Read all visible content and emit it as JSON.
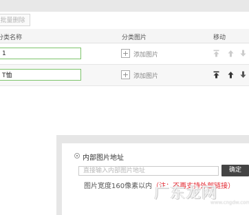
{
  "toolbar": {
    "batch_delete_label": "批量删除"
  },
  "table": {
    "headers": {
      "name": "分类名称",
      "image": "分类图片",
      "move": "移动"
    },
    "rows": [
      {
        "name_value": "1",
        "add_image_label": "添加图片",
        "arrows_enabled": false
      },
      {
        "name_value": "T恤",
        "add_image_label": "添加图片",
        "arrows_enabled": true
      }
    ]
  },
  "icons": {
    "add": "plus-icon",
    "move_top": "move-to-top-icon",
    "move_up": "move-up-icon",
    "move_down": "move-down-icon"
  },
  "popup": {
    "radio_label": "内部图片地址",
    "input_placeholder": "直接输入内部图片地址",
    "confirm_label": "确定",
    "hint_text": "图片宽度160像素以内",
    "hint_warning": "（注：不再支持外部链接）"
  },
  "watermark": {
    "text": "广东龙网",
    "sub": "www.cngdw.com"
  },
  "colors": {
    "input_border_active": "#7cc36a",
    "confirm_bg": "#444444",
    "warning": "#e2262f",
    "arrow_disabled": "#cccccc",
    "arrow_enabled": "#333333"
  }
}
